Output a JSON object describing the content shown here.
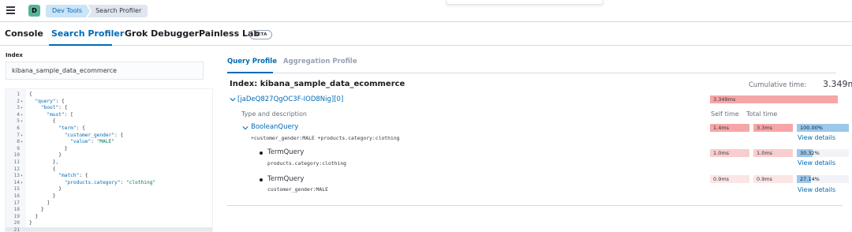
{
  "header": {
    "space_initial": "D",
    "breadcrumbs": [
      "Dev Tools",
      "Search Profiler"
    ]
  },
  "tabs": [
    "Console",
    "Search Profiler",
    "Grok Debugger",
    "Painless Lab"
  ],
  "beta_label": "BETA",
  "index": {
    "label": "Index",
    "value": "kibana_sample_data_ecommerce"
  },
  "editor": {
    "lines": [
      "{",
      "  \"query\": {",
      "    \"bool\": {",
      "      \"must\": [",
      "        {",
      "          \"term\": {",
      "            \"customer_gender\": {",
      "              \"value\": \"MALE\"",
      "            }",
      "          }",
      "        },",
      "        {",
      "          \"match\": {",
      "            \"products.category\": \"clothing\"",
      "          }",
      "        }",
      "      ]",
      "    }",
      "  }",
      "}",
      ""
    ],
    "folds": [
      1,
      2,
      3,
      4,
      6,
      7,
      12,
      13
    ]
  },
  "profile_tabs": [
    "Query Profile",
    "Aggregation Profile"
  ],
  "results": {
    "index_title": "Index: kibana_sample_data_ecommerce",
    "cumulative_label": "Cumulative time:",
    "cumulative_value": "3.349ms",
    "shard": {
      "id": "[jaDeQ827QgOC3F-IOD8Nig][0]",
      "time": "3.349ms"
    },
    "headers": {
      "desc": "Type and description",
      "self": "Self time",
      "total": "Total time"
    },
    "queries": [
      {
        "name": "BooleanQuery",
        "desc": "+customer_gender:MALE +products.category:clothing",
        "self": "1.4ms",
        "total": "3.3ms",
        "pct": "100.00%",
        "pct_value": 100.0,
        "view": "View details"
      },
      {
        "name": "TermQuery",
        "desc": "products.category:clothing",
        "self": "1.0ms",
        "total": "1.0ms",
        "pct": "30.32%",
        "pct_value": 30.32,
        "view": "View details"
      },
      {
        "name": "TermQuery",
        "desc": "customer_gender:MALE",
        "self": "0.9ms",
        "total": "0.9ms",
        "pct": "27.14%",
        "pct_value": 27.14,
        "view": "View details"
      }
    ]
  },
  "colors": {
    "accent": "#006bb8",
    "time_bar_high": "#f6a6a6",
    "time_bar_mid": "#f8cdcd",
    "time_bar_low": "#fbe5e5",
    "percent_bar": "#9bc8eb"
  }
}
